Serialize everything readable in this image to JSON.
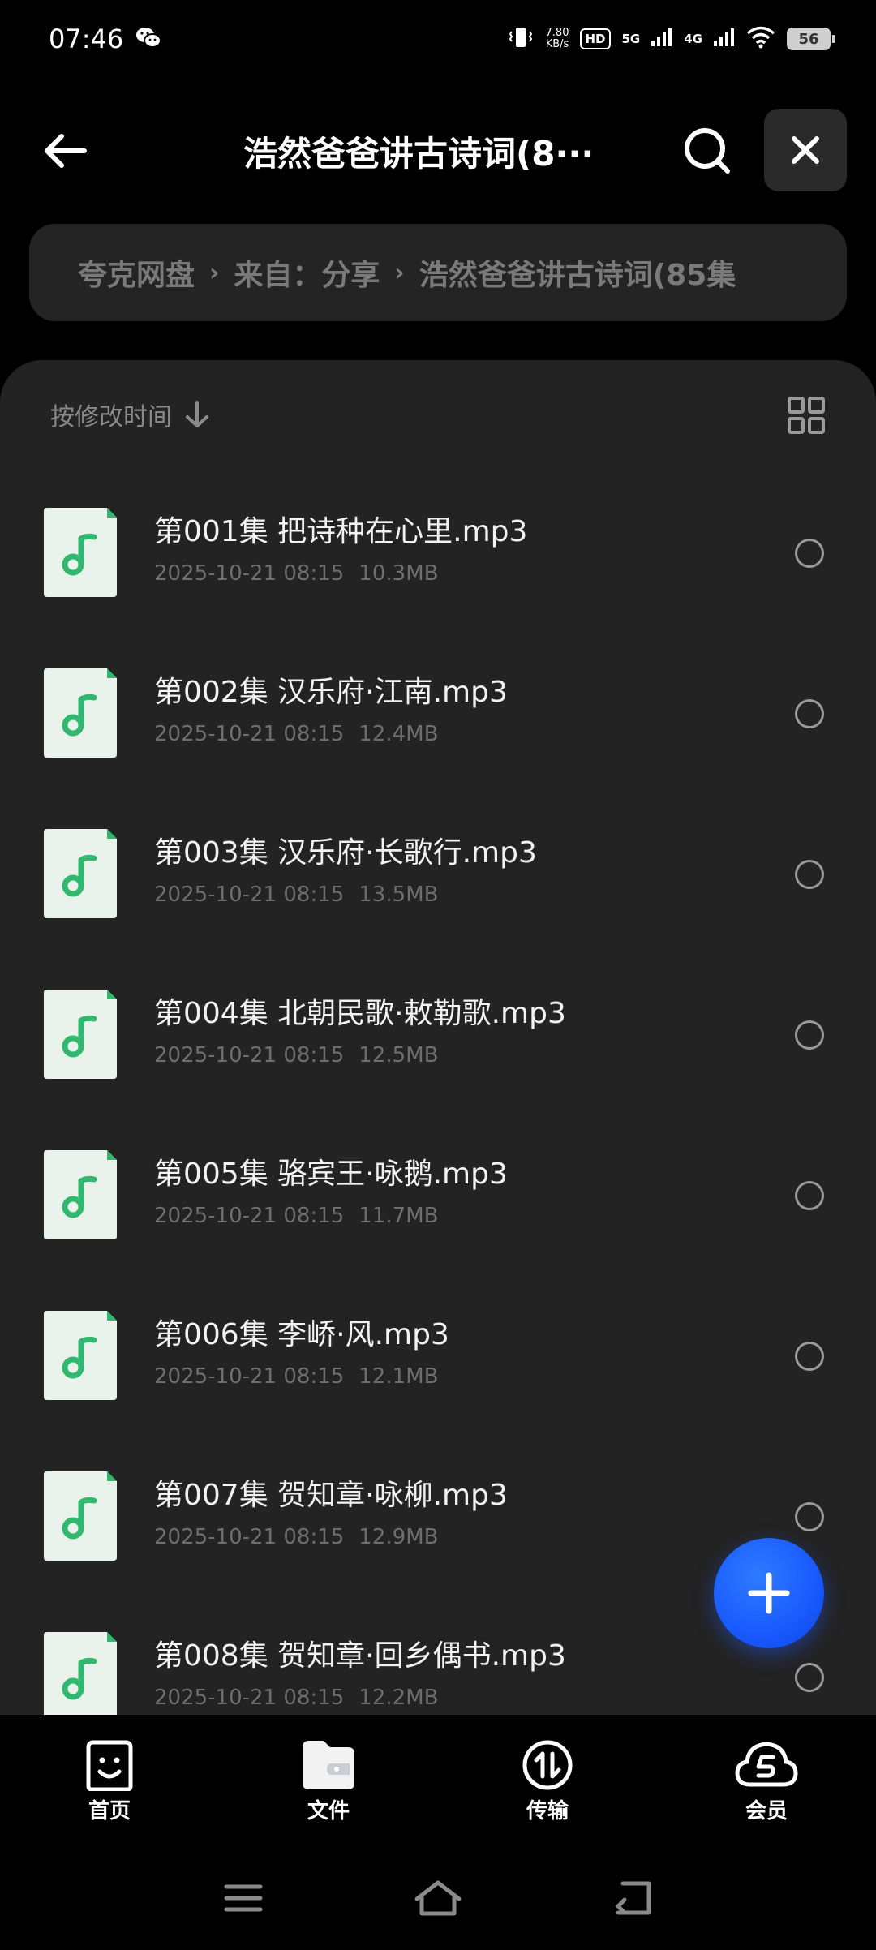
{
  "status_bar": {
    "time": "07:46",
    "net_speed_value": "7.80",
    "net_speed_unit": "KB/s",
    "hd_label": "HD",
    "net_type_1": "5G",
    "net_type_2": "4G",
    "battery": "56"
  },
  "header": {
    "title": "浩然爸爸讲古诗词(8···"
  },
  "breadcrumb": {
    "items": [
      "夸克网盘",
      "来自：分享",
      "浩然爸爸讲古诗词(85集"
    ]
  },
  "sort": {
    "label": "按修改时间"
  },
  "files": [
    {
      "name": "第001集 把诗种在心里.mp3",
      "date": "2025-10-21 08:15",
      "size": "10.3MB"
    },
    {
      "name": "第002集 汉乐府·江南.mp3",
      "date": "2025-10-21 08:15",
      "size": "12.4MB"
    },
    {
      "name": "第003集 汉乐府·长歌行.mp3",
      "date": "2025-10-21 08:15",
      "size": "13.5MB"
    },
    {
      "name": "第004集 北朝民歌·敕勒歌.mp3",
      "date": "2025-10-21 08:15",
      "size": "12.5MB"
    },
    {
      "name": "第005集 骆宾王·咏鹅.mp3",
      "date": "2025-10-21 08:15",
      "size": "11.7MB"
    },
    {
      "name": "第006集 李峤·风.mp3",
      "date": "2025-10-21 08:15",
      "size": "12.1MB"
    },
    {
      "name": "第007集 贺知章·咏柳.mp3",
      "date": "2025-10-21 08:15",
      "size": "12.9MB"
    },
    {
      "name": "第008集 贺知章·回乡偶书.mp3",
      "date": "2025-10-21 08:15",
      "size": "12.2MB"
    }
  ],
  "bottom_nav": {
    "items": [
      {
        "label": "首页",
        "icon": "smiley-icon"
      },
      {
        "label": "文件",
        "icon": "folder-icon"
      },
      {
        "label": "传输",
        "icon": "transfer-icon"
      },
      {
        "label": "会员",
        "icon": "cloud-vip-icon"
      }
    ]
  },
  "colors": {
    "background": "#000000",
    "panel": "#232323",
    "accent_blue": "#1a5cff",
    "music_green": "#2fb86e"
  }
}
